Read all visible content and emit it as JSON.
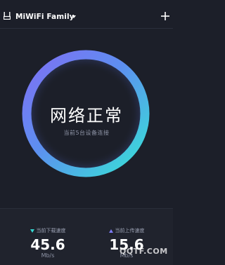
{
  "header": {
    "wifi_name": "MiWiFi Family",
    "icons": {
      "router": "router-icon",
      "dropdown": "chevron-down-icon",
      "add": "plus-icon"
    }
  },
  "status": {
    "title": "网络正常",
    "subtitle": "当前5台设备连接"
  },
  "download": {
    "label": "当前下载速度",
    "value": "45.6",
    "unit": "Mb/s"
  },
  "upload": {
    "label": "当前上传速度",
    "value": "15.6",
    "unit": "Mb/s"
  },
  "watermark": "QQTF.COM",
  "colors": {
    "background": "#1c1f29",
    "ring_start": "#7f6ff4",
    "ring_end": "#36e3d6",
    "download_accent": "#35d6d0",
    "upload_accent": "#7d7bf5"
  }
}
